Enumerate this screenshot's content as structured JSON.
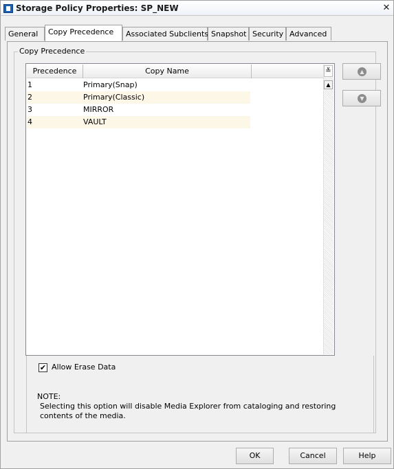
{
  "window": {
    "title": "Storage Policy Properties: SP_NEW",
    "close_glyph": "✕"
  },
  "tabs": [
    {
      "label": "General",
      "active": false
    },
    {
      "label": "Copy Precedence",
      "active": true
    },
    {
      "label": "Associated Subclients",
      "active": false
    },
    {
      "label": "Snapshot",
      "active": false
    },
    {
      "label": "Security",
      "active": false
    },
    {
      "label": "Advanced",
      "active": false
    }
  ],
  "group": {
    "label": "Copy Precedence"
  },
  "grid": {
    "columns": [
      "Precedence",
      "Copy Name"
    ],
    "rows": [
      {
        "precedence": "1",
        "copy_name": "Primary(Snap)"
      },
      {
        "precedence": "2",
        "copy_name": "Primary(Classic)"
      },
      {
        "precedence": "3",
        "copy_name": "MIRROR"
      },
      {
        "precedence": "4",
        "copy_name": "VAULT"
      }
    ],
    "collapse_glyph": "≚",
    "scroll_up_glyph": "▲"
  },
  "side_buttons": {
    "move_up_icon": "arrow-up-icon",
    "move_down_icon": "arrow-down-icon",
    "up_glyph": "▲",
    "down_glyph": "▼"
  },
  "options": {
    "allow_erase_label": "Allow Erase Data",
    "allow_erase_checked": true,
    "check_glyph": "✔",
    "note_title": "NOTE:",
    "note_text": "Selecting this option will disable Media Explorer from cataloging and restoring contents of the media."
  },
  "buttons": {
    "ok": "OK",
    "cancel": "Cancel",
    "help": "Help"
  },
  "colors": {
    "row_alt": "#fdf7e8",
    "title_icon": "#1d5fb4"
  }
}
